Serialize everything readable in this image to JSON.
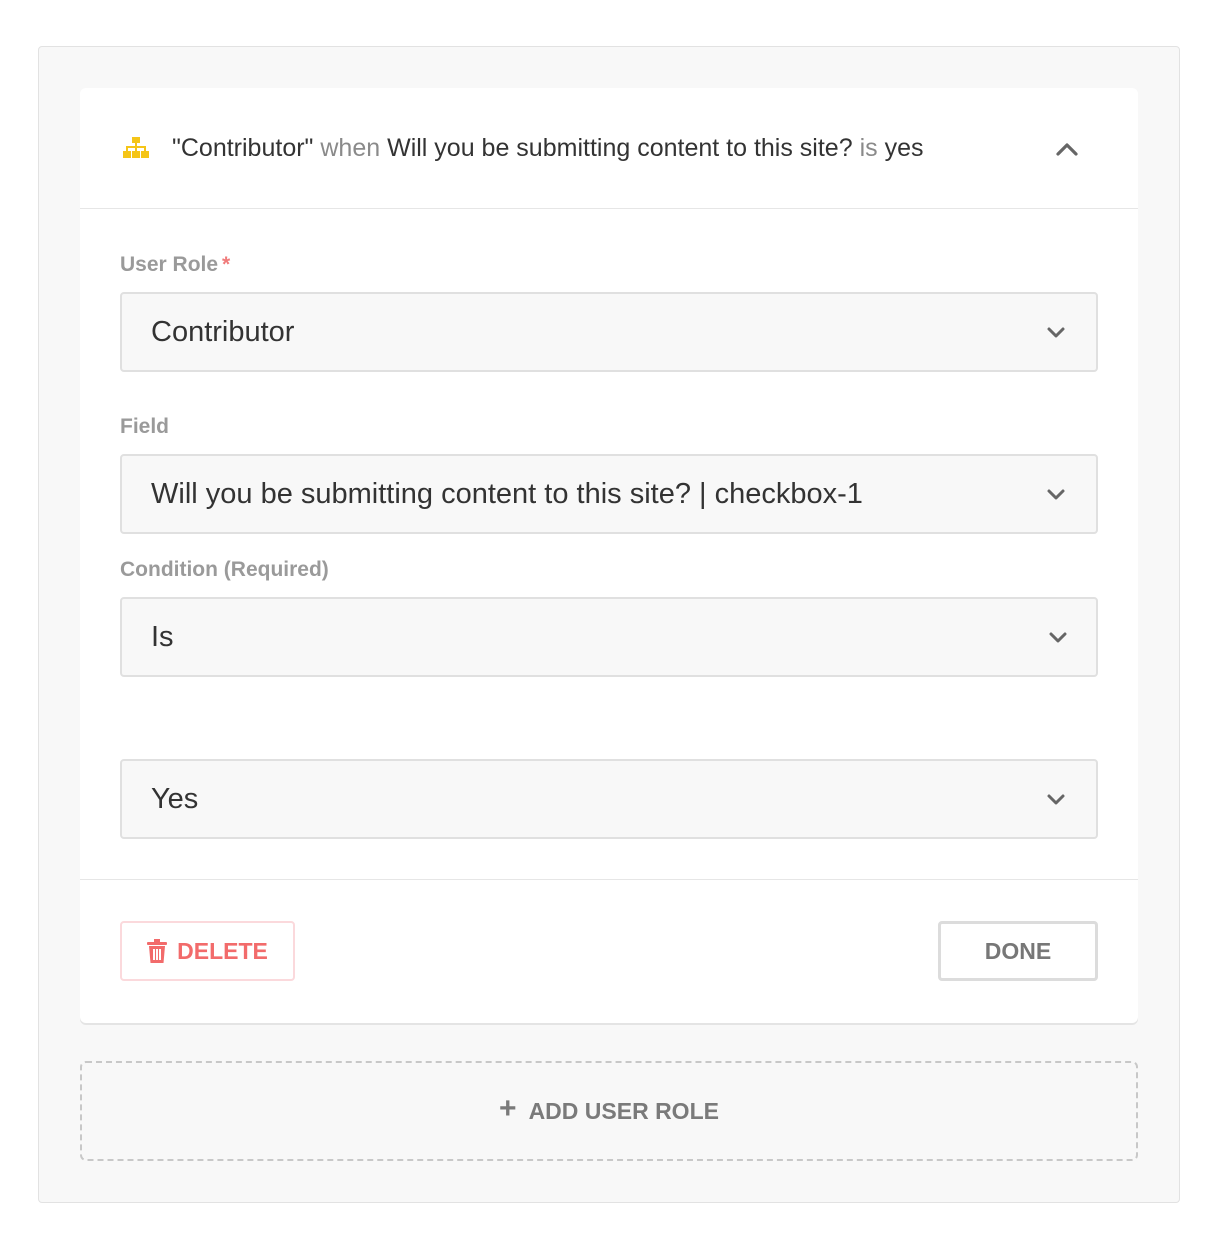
{
  "colors": {
    "accent_icon": "#f5c518",
    "danger": "#f26b6b",
    "required": "#f07a7a",
    "muted_text": "#9a9a9a"
  },
  "rule": {
    "summary": {
      "role": "\"Contributor\"",
      "when": "when",
      "field": "Will you be submitting content to this site?",
      "is": "is",
      "value": "yes"
    },
    "icons": {
      "header": "sitemap-icon",
      "collapse": "chevron-up-icon",
      "select": "chevron-down-icon",
      "delete": "trash-icon"
    },
    "user_role": {
      "label": "User Role",
      "required_mark": "*",
      "value": "Contributor"
    },
    "field": {
      "label": "Field",
      "value": "Will you be submitting content to this site? | checkbox-1"
    },
    "condition": {
      "label": "Condition (Required)",
      "value": "Is"
    },
    "condition_value": {
      "value": "Yes"
    },
    "footer": {
      "delete_label": "DELETE",
      "done_label": "DONE"
    }
  },
  "add_user_role": {
    "plus": "+",
    "label": "ADD USER ROLE"
  }
}
